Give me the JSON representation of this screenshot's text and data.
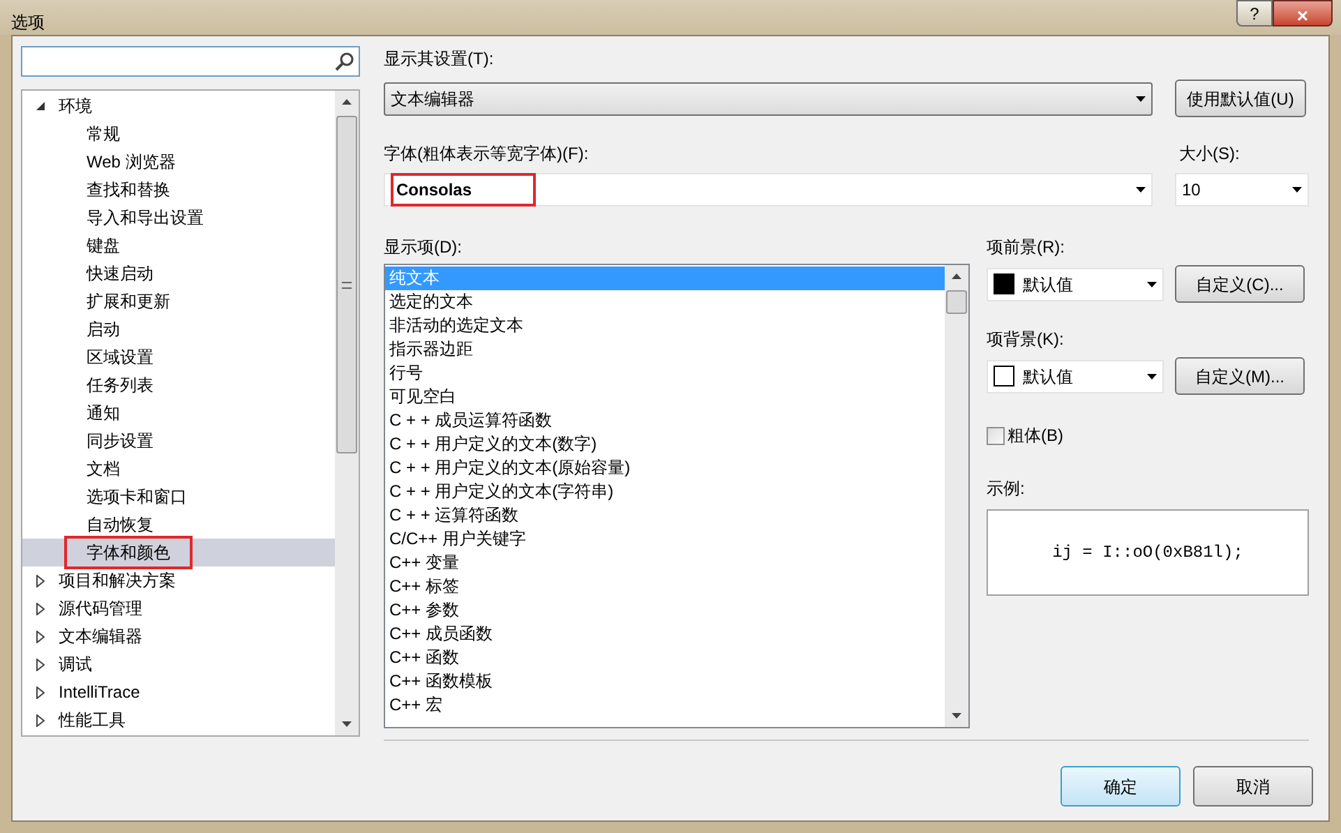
{
  "window": {
    "title": "选项",
    "help": "?",
    "close": "×"
  },
  "tree": [
    {
      "label": "环境",
      "expanded": true,
      "children": [
        {
          "label": "常规",
          "selected": false,
          "annotated": false
        },
        {
          "label": "Web 浏览器",
          "selected": false,
          "annotated": false
        },
        {
          "label": "查找和替换",
          "selected": false,
          "annotated": false
        },
        {
          "label": "导入和导出设置",
          "selected": false,
          "annotated": false
        },
        {
          "label": "键盘",
          "selected": false,
          "annotated": false
        },
        {
          "label": "快速启动",
          "selected": false,
          "annotated": false
        },
        {
          "label": "扩展和更新",
          "selected": false,
          "annotated": false
        },
        {
          "label": "启动",
          "selected": false,
          "annotated": false
        },
        {
          "label": "区域设置",
          "selected": false,
          "annotated": false
        },
        {
          "label": "任务列表",
          "selected": false,
          "annotated": false
        },
        {
          "label": "通知",
          "selected": false,
          "annotated": false
        },
        {
          "label": "同步设置",
          "selected": false,
          "annotated": false
        },
        {
          "label": "文档",
          "selected": false,
          "annotated": false
        },
        {
          "label": "选项卡和窗口",
          "selected": false,
          "annotated": false
        },
        {
          "label": "自动恢复",
          "selected": false,
          "annotated": false
        },
        {
          "label": "字体和颜色",
          "selected": true,
          "annotated": true
        }
      ]
    },
    {
      "label": "项目和解决方案",
      "expanded": false
    },
    {
      "label": "源代码管理",
      "expanded": false
    },
    {
      "label": "文本编辑器",
      "expanded": false
    },
    {
      "label": "调试",
      "expanded": false
    },
    {
      "label": "IntelliTrace",
      "expanded": false
    },
    {
      "label": "性能工具",
      "expanded": false
    }
  ],
  "show_settings_for": {
    "label": "显示其设置(T):",
    "value": "文本编辑器"
  },
  "use_defaults_button": "使用默认值(U)",
  "font": {
    "label": "字体(粗体表示等宽字体)(F):",
    "value": "Consolas",
    "annotated": true
  },
  "size": {
    "label": "大小(S):",
    "value": "10"
  },
  "display_items": {
    "label": "显示项(D):",
    "items": [
      {
        "label": "纯文本",
        "selected": true
      },
      {
        "label": "选定的文本",
        "selected": false
      },
      {
        "label": "非活动的选定文本",
        "selected": false
      },
      {
        "label": "指示器边距",
        "selected": false
      },
      {
        "label": "行号",
        "selected": false
      },
      {
        "label": "可见空白",
        "selected": false
      },
      {
        "label": "C + + 成员运算符函数",
        "selected": false
      },
      {
        "label": "C + + 用户定义的文本(数字)",
        "selected": false
      },
      {
        "label": "C + + 用户定义的文本(原始容量)",
        "selected": false
      },
      {
        "label": "C + + 用户定义的文本(字符串)",
        "selected": false
      },
      {
        "label": "C + + 运算符函数",
        "selected": false
      },
      {
        "label": "C/C++ 用户关键字",
        "selected": false
      },
      {
        "label": "C++ 变量",
        "selected": false
      },
      {
        "label": "C++ 标签",
        "selected": false
      },
      {
        "label": "C++ 参数",
        "selected": false
      },
      {
        "label": "C++ 成员函数",
        "selected": false
      },
      {
        "label": "C++ 函数",
        "selected": false
      },
      {
        "label": "C++ 函数模板",
        "selected": false
      },
      {
        "label": "C++ 宏",
        "selected": false
      }
    ]
  },
  "foreground": {
    "label": "项前景(R):",
    "value": "默认值",
    "color": "#000000",
    "button": "自定义(C)..."
  },
  "background": {
    "label": "项背景(K):",
    "value": "默认值",
    "color": "#ffffff",
    "button": "自定义(M)..."
  },
  "bold": {
    "label": "粗体(B)",
    "checked": false
  },
  "sample": {
    "label": "示例:",
    "text": "ij = I::oO(0xB81l);"
  },
  "buttons": [
    {
      "label": "确定",
      "default": true
    },
    {
      "label": "取消",
      "default": false
    }
  ]
}
